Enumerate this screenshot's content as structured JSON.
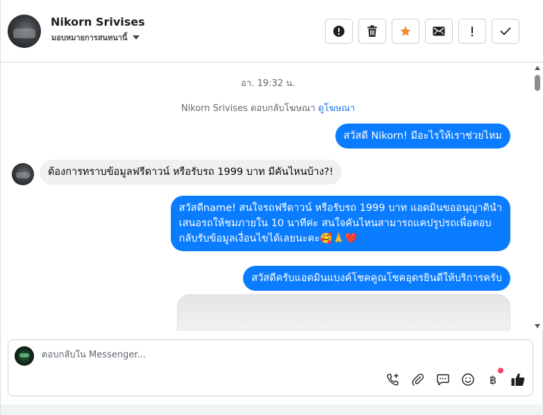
{
  "header": {
    "contact_name": "Nikorn Srivises",
    "assign_label": "มอบหมายการสนทนานี้",
    "actions": [
      {
        "name": "report-button",
        "icon": "alert-circle-icon"
      },
      {
        "name": "delete-button",
        "icon": "trash-icon"
      },
      {
        "name": "star-button",
        "icon": "star-icon",
        "color": "#f28b30"
      },
      {
        "name": "mail-button",
        "icon": "envelope-icon"
      },
      {
        "name": "mark-important-button",
        "icon": "exclamation-icon"
      },
      {
        "name": "mark-done-button",
        "icon": "check-icon"
      }
    ]
  },
  "thread": {
    "timestamp": "อา. 19:32 น.",
    "ad_note_text": "Nikorn Srivises ตอบกลับโฆษณา",
    "ad_note_link": "ดูโฆษณา",
    "messages": [
      {
        "direction": "out",
        "text": "สวัสดี Nikorn! มีอะไรให้เราช่วยไหม"
      },
      {
        "direction": "in",
        "text": "ต้องการทราบข้อมูลฟรีดาวน์ หรือรับรถ 1999 บาท มีคันไหนบ้าง?!"
      },
      {
        "direction": "out",
        "lines": [
          "สวัสดีname! สนใจรถฟรีดาวน์ หรือรับรถ 1999 บาท แอดมินขออนุญาตินำ",
          "เสนอรถให้ชมภายใน 10 นาทีค่ะ สนใจคันไหนสามารถแคปรูปรถเพื่อตอบ",
          "กลับรับข้อมูลเงื่อนไขได้เลยนะคะ🥰🙏❤️"
        ]
      },
      {
        "direction": "out",
        "text": "สวัสดีครับแอดมินแบงค์โชคคูณโชคอุดรยินดีให้บริการครับ"
      }
    ]
  },
  "composer": {
    "placeholder": "ตอบกลับใน Messenger...",
    "tools": [
      "phone-plus-icon",
      "paperclip-icon",
      "chat-bubble-icon",
      "smiley-icon",
      "baht-icon",
      "thumbs-up-icon"
    ],
    "baht_symbol": "฿"
  },
  "colors": {
    "accent": "#0a7cff",
    "star": "#f28b30",
    "notification_dot": "#f3425f"
  }
}
